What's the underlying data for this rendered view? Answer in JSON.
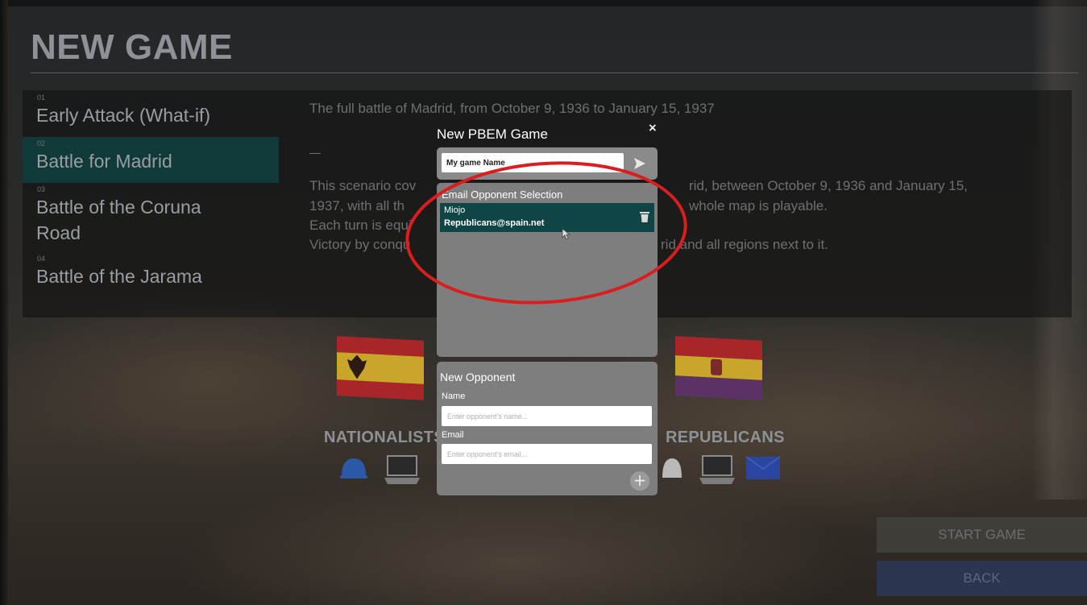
{
  "page": {
    "title": "NEW GAME"
  },
  "scenarios": [
    {
      "number": "01",
      "name": "Early Attack (What-if)",
      "selected": false
    },
    {
      "number": "02",
      "name": "Battle for Madrid",
      "selected": true
    },
    {
      "number": "03",
      "name": "Battle of the Coruna\nRoad",
      "selected": false
    },
    {
      "number": "04",
      "name": "Battle of the Jarama",
      "selected": false
    }
  ],
  "description": {
    "summary": "The full battle of Madrid, from October 9, 1936 to January 15, 1937",
    "dash": "–",
    "lines": [
      "This scenario cov",
      "1937, with all th",
      "Each turn is equi",
      "Victory by conqu"
    ],
    "line_tails": [
      "rid, between October 9, 1936 and January 15,",
      "whole map is playable.",
      "",
      "rid and all regions next to it."
    ]
  },
  "sides": {
    "left": {
      "label": "NATIONALISTS",
      "icons": [
        "helmet-icon",
        "computer-icon"
      ]
    },
    "right": {
      "label": "REPUBLICANS",
      "icons": [
        "helmet-icon",
        "computer-icon",
        "mail-icon"
      ]
    }
  },
  "buttons": {
    "start": "START GAME",
    "back": "BACK"
  },
  "dialog": {
    "title": "New PBEM Game",
    "close": "×",
    "game_name_value": "My game Name",
    "selection_header": "Email Opponent Selection",
    "opponents": [
      {
        "name": "Miojo",
        "email": "Republicans@spain.net"
      }
    ],
    "new_opponent": {
      "header": "New Opponent",
      "name_label": "Name",
      "name_placeholder": "Enter opponent's name...",
      "email_label": "Email",
      "email_placeholder": "Enter opponent's email..."
    },
    "add": "+"
  },
  "colors": {
    "selected_row": "#0f3a39",
    "opponent_row": "#0f4645",
    "highlight_ring": "#d81e1e",
    "back_button": "#2c3550"
  }
}
